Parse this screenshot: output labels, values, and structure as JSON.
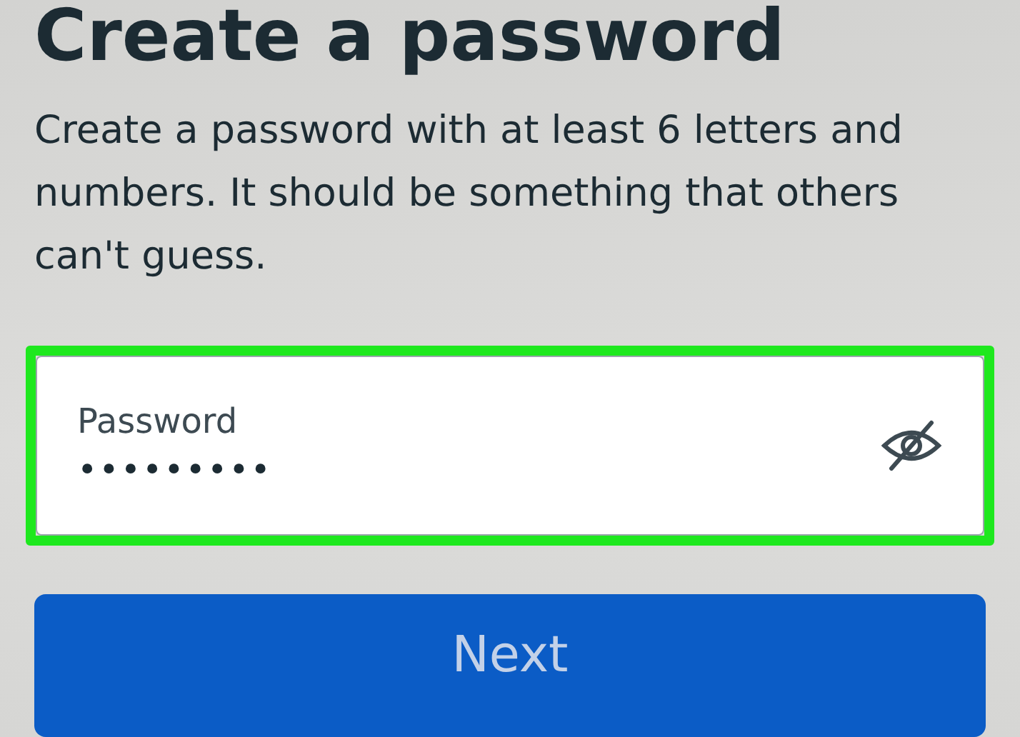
{
  "title": "Create a password",
  "description": "Create a password with at least 6 letters and numbers. It should be something that others can't guess.",
  "password_field": {
    "label": "Password",
    "value": "•••••••••",
    "highlighted": true,
    "visible": false
  },
  "next_button": {
    "label": "Next"
  }
}
